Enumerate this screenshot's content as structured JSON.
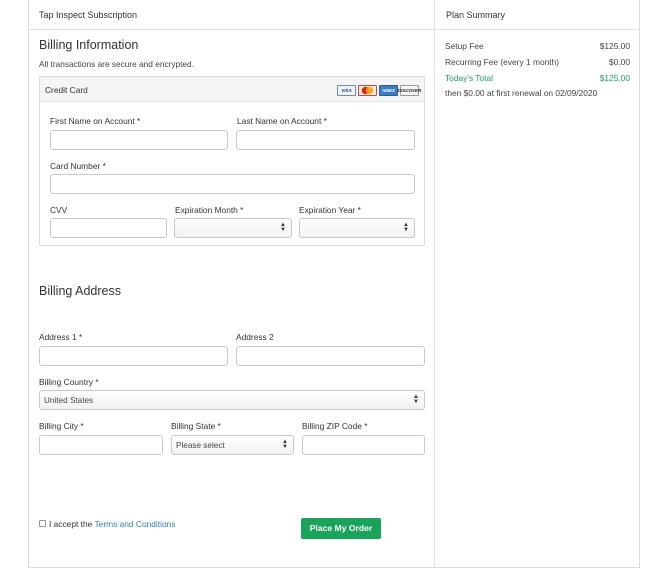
{
  "header": {
    "title": "Tap Inspect Subscription",
    "summary_title": "Plan Summary"
  },
  "billing": {
    "title": "Billing Information",
    "secure_note": "All transactions are secure and encrypted.",
    "credit_card_label": "Credit Card",
    "card_logos": [
      "VISA",
      "MasterCard",
      "AMEX",
      "DISCOVER"
    ],
    "first_name_label": "First Name on Account *",
    "last_name_label": "Last Name on Account *",
    "card_number_label": "Card Number *",
    "cvv_label": "CVV",
    "exp_month_label": "Expiration Month *",
    "exp_year_label": "Expiration Year *",
    "exp_month_value": "",
    "exp_year_value": ""
  },
  "address": {
    "title": "Billing Address",
    "address1_label": "Address 1 *",
    "address2_label": "Address 2",
    "country_label": "Billing Country *",
    "country_value": "United States",
    "city_label": "Billing City *",
    "state_label": "Billing State *",
    "state_value": "Please select",
    "zip_label": "Billing ZIP Code *"
  },
  "terms": {
    "prefix": "I accept the ",
    "link": "Terms and Conditions"
  },
  "order_button": "Place My Order",
  "summary": {
    "setup_fee_label": "Setup Fee",
    "setup_fee_value": "$125.00",
    "recurring_label": "Recurring Fee (every 1 month)",
    "recurring_value": "$0.00",
    "today_label": "Today's Total",
    "today_value": "$125.00",
    "renewal_note": "then $0.00 at first renewal on 02/09/2020"
  },
  "colors": {
    "accent_green": "#1aa35a",
    "link_blue": "#2c7fc5"
  }
}
